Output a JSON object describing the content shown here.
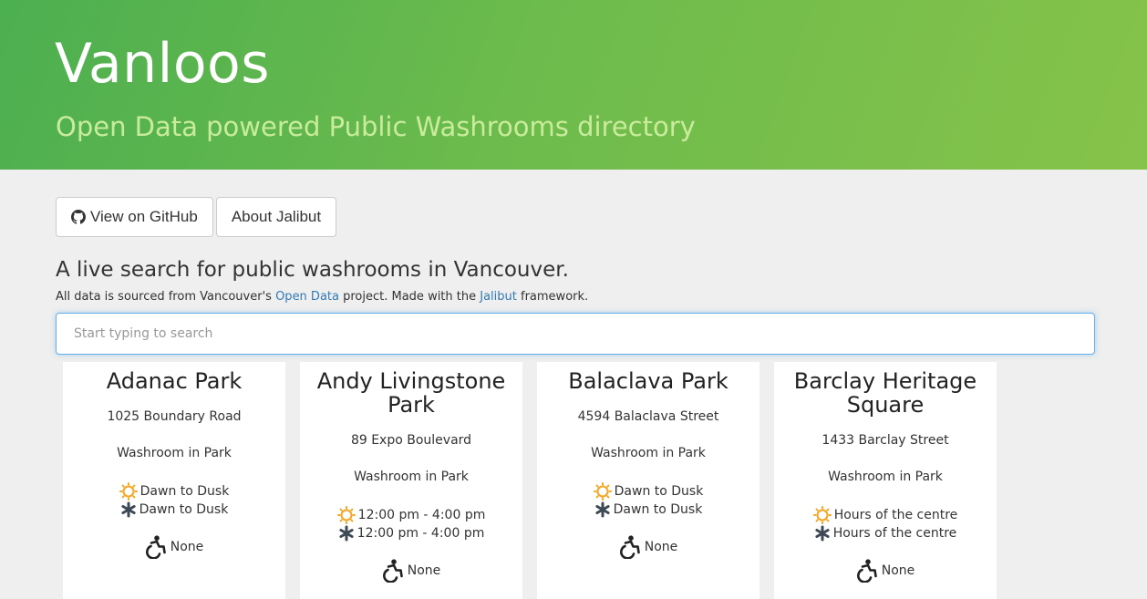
{
  "header": {
    "title": "Vanloos",
    "subtitle": "Open Data powered Public Washrooms directory"
  },
  "buttons": {
    "github": "View on GitHub",
    "about": "About Jalibut"
  },
  "intro": {
    "lead": "A live search for public washrooms in Vancouver.",
    "sub_1": "All data is sourced from Vancouver's ",
    "link_open_data": "Open Data",
    "sub_2": " project. Made with the ",
    "link_jalibut": "Jalibut",
    "sub_3": " framework."
  },
  "search": {
    "placeholder": "Start typing to search",
    "value": ""
  },
  "colors": {
    "accent_green": "#4caf50",
    "link": "#337ab7",
    "sun_icon": "#f5a623",
    "snowflake_icon": "#3d4a55"
  },
  "cards": [
    {
      "name": "Adanac Park",
      "address": "1025 Boundary Road",
      "type": "Washroom in Park",
      "summer_hours": "Dawn to Dusk",
      "winter_hours": "Dawn to Dusk",
      "wheelchair": "None"
    },
    {
      "name": "Andy Livingstone Park",
      "address": "89 Expo Boulevard",
      "type": "Washroom in Park",
      "summer_hours": "12:00 pm - 4:00 pm",
      "winter_hours": "12:00 pm - 4:00 pm",
      "wheelchair": "None"
    },
    {
      "name": "Balaclava Park",
      "address": "4594 Balaclava Street",
      "type": "Washroom in Park",
      "summer_hours": "Dawn to Dusk",
      "winter_hours": "Dawn to Dusk",
      "wheelchair": "None"
    },
    {
      "name": "Barclay Heritage Square",
      "address": "1433 Barclay Street",
      "type": "Washroom in Park",
      "summer_hours": "Hours of the centre",
      "winter_hours": "Hours of the centre",
      "wheelchair": "None"
    }
  ]
}
